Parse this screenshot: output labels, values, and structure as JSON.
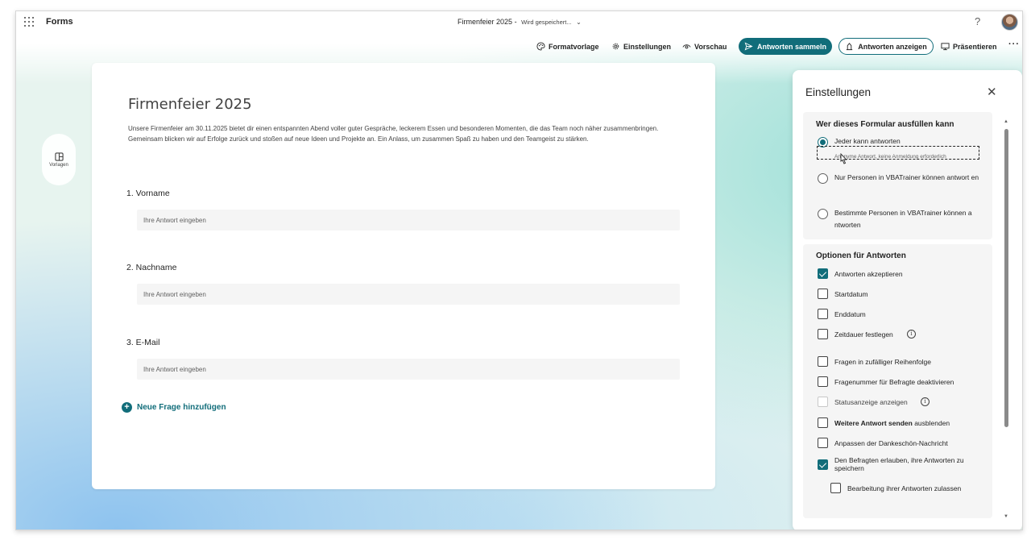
{
  "app": {
    "name": "Forms"
  },
  "header": {
    "form_title": "Firmenfeier 2025",
    "separator": "-",
    "save_status": "Wird gespeichert...",
    "help": "?"
  },
  "toolbar": {
    "format_label": "Formatvorlage",
    "settings_label": "Einstellungen",
    "preview_label": "Vorschau",
    "collect_label": "Antworten sammeln",
    "responses_label": "Antworten anzeigen",
    "present_label": "Präsentieren",
    "more": "···"
  },
  "sidebar": {
    "templates_label": "Vorlagen"
  },
  "form": {
    "title": "Firmenfeier 2025",
    "description": "Unsere Firmenfeier am 30.11.2025 bietet dir einen entspannten Abend voller guter Gespräche, leckerem Essen und besonderen Momenten, die das Team noch näher zusammenbringen. Gemeinsam blicken wir auf Erfolge zurück und stoßen auf neue Ideen und Projekte an. Ein Anlass, um zusammen Spaß zu haben und den Teamgeist zu stärken.",
    "questions": [
      {
        "label": "1. Vorname",
        "placeholder": "Ihre Antwort eingeben"
      },
      {
        "label": "2. Nachname",
        "placeholder": "Ihre Antwort eingeben"
      },
      {
        "label": "3. E-Mail",
        "placeholder": "Ihre Antwort eingeben"
      }
    ],
    "add_question_label": "Neue Frage hinzufügen"
  },
  "settings_panel": {
    "title": "Einstellungen",
    "who_section": {
      "title": "Wer dieses Formular ausfüllen kann",
      "options": [
        {
          "label": "Jeder kann antworten",
          "sub": "Anonyme Antwort, keine Anmeldung erforderlich",
          "selected": true
        },
        {
          "label": "Nur Personen in VBATrainer können antwort en",
          "selected": false
        },
        {
          "label": "Bestimmte Personen in VBATrainer können a ntworten",
          "selected": false
        }
      ]
    },
    "options_section": {
      "title": "Optionen für Antworten",
      "accept": {
        "label": "Antworten akzeptieren",
        "checked": true
      },
      "start_date": {
        "label": "Startdatum",
        "checked": false
      },
      "end_date": {
        "label": "Enddatum",
        "checked": false
      },
      "time_limit": {
        "label": "Zeitdauer festlegen",
        "checked": false
      },
      "shuffle": {
        "label": "Fragen in zufälliger Reihenfolge",
        "checked": false
      },
      "disable_numbers": {
        "label": "Fragenummer für Befragte deaktivieren",
        "checked": false
      },
      "progress_bar": {
        "label": "Statusanzeige anzeigen",
        "checked": false,
        "disabled": true
      },
      "hide_another_bold": "Weitere Antwort senden",
      "hide_another_rest": " ausblenden",
      "thank_you": {
        "label": "Anpassen der Dankeschön-Nachricht",
        "checked": false
      },
      "save_responses": {
        "label": "Den Befragten erlauben, ihre Antworten zu speichern",
        "checked": true
      },
      "allow_edit": {
        "label": "Bearbeitung ihrer Antworten zulassen",
        "checked": false
      }
    },
    "info_glyph": "i"
  },
  "colors": {
    "accent": "#116d7a"
  }
}
